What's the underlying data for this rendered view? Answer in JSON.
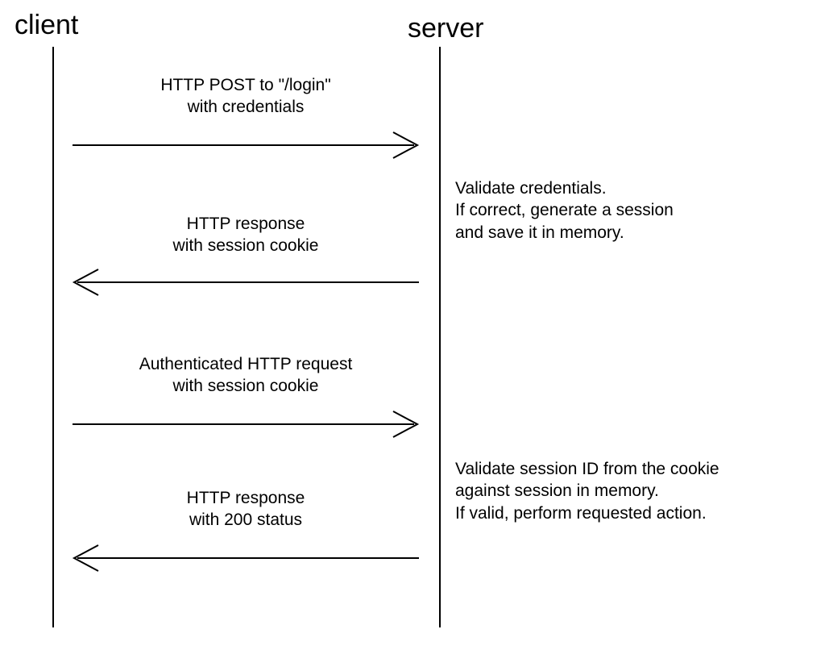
{
  "actors": {
    "client": "client",
    "server": "server"
  },
  "messages": {
    "m1": {
      "line1": "HTTP POST to \"/login\"",
      "line2": "with credentials"
    },
    "m2": {
      "line1": "HTTP response",
      "line2": "with session cookie"
    },
    "m3": {
      "line1": "Authenticated HTTP request",
      "line2": "with session cookie"
    },
    "m4": {
      "line1": "HTTP response",
      "line2": "with 200 status"
    }
  },
  "notes": {
    "n1": {
      "line1": "Validate credentials.",
      "line2": "If correct, generate a session",
      "line3": "and save it in memory."
    },
    "n2": {
      "line1": "Validate session ID from the cookie",
      "line2": "against session in memory.",
      "line3": "If valid, perform requested action."
    }
  }
}
